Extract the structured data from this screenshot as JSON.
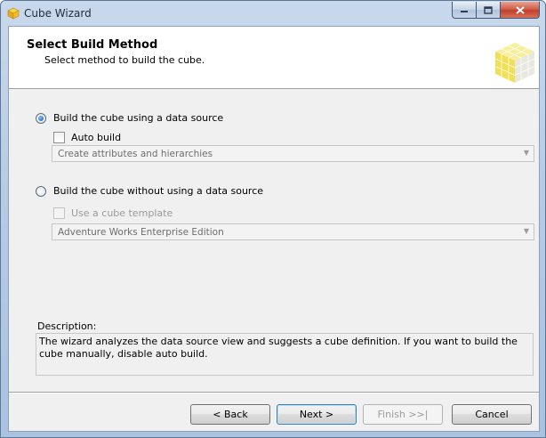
{
  "window": {
    "title": "Cube Wizard"
  },
  "header": {
    "title": "Select Build Method",
    "subtitle": "Select method to build the cube."
  },
  "options": {
    "with_source": {
      "label": "Build the cube using a data source",
      "selected": true
    },
    "auto_build": {
      "label": "Auto build",
      "checked": false
    },
    "auto_build_combo": {
      "value": "Create attributes and hierarchies"
    },
    "without_source": {
      "label": "Build the cube without using a data source",
      "selected": false
    },
    "use_template": {
      "label": "Use a cube template",
      "checked": false
    },
    "template_combo": {
      "value": "Adventure Works Enterprise Edition"
    }
  },
  "description": {
    "label": "Description:",
    "text": "The wizard analyzes the data source view and suggests a cube definition. If you want to build the cube manually, disable auto build."
  },
  "buttons": {
    "back": "< Back",
    "next": "Next >",
    "finish": "Finish >>|",
    "cancel": "Cancel"
  },
  "icons": {
    "app": "cube-icon",
    "minimize": "minimize-icon",
    "maximize": "maximize-icon",
    "close": "close-icon",
    "dropdown": "chevron-down-icon"
  }
}
